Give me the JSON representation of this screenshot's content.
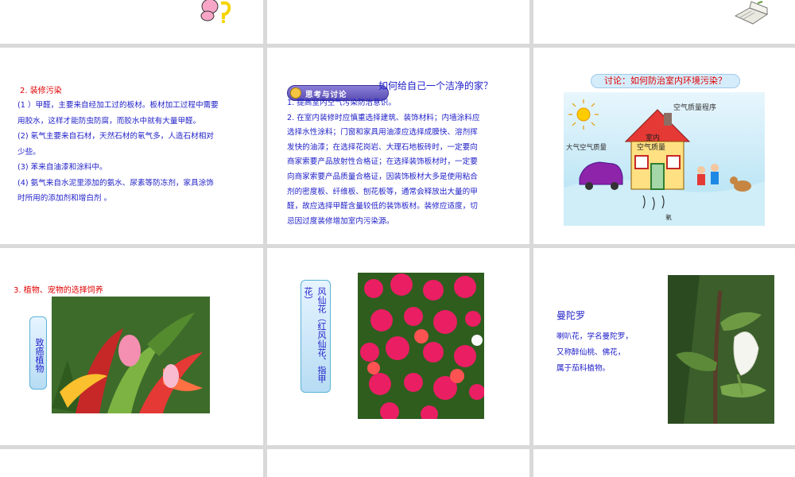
{
  "slide_row1_middle": {
    "title": "2. 装修污染",
    "lines": [
      "(1 ）甲醛，主要来自经加工过的板材。板材加工过程中需要",
      "用胶水，这样才能防虫防腐，而胶水中就有大量甲醛。",
      "(2) 氡气主要来自石材，天然石材的氡气多，人造石材相对",
      "少些。",
      "(3) 苯来自油漆和涂料中。",
      "(4) 氨气来自水泥里添加的氨水、尿素等防冻剂，家具涂饰",
      "时所用的添加剂和增白剂 。"
    ]
  },
  "slide_think": {
    "badge": "思考与讨论",
    "question": "如何给自己一个洁净的家？",
    "lines": [
      "1. 提高室内空气污染防治意识。",
      "2. 在室内装修时应慎重选择建筑、装饰材料；内墙涂料应",
      "选择水性涂料；门窗和家具用油漆应选择成膜快、溶剂挥",
      "发快的油漆；在选择花岗岩、大理石地板砖时，一定要向",
      "商家索要产品放射性合格证；在选择装饰板材时，一定要",
      "向商家索要产品质量合格证，因装饰板材大多是使用粘合",
      "剂的密度板、纤维板、刨花板等，通常会释放出大量的甲",
      "醛，故应选择甲醛含量较低的装饰板材。装修应适度，切",
      "忌因过度装修增加室内污染源。"
    ]
  },
  "slide_discuss": {
    "title": "讨论：如何防治室内环境污染？",
    "labels": {
      "program": "空气质量程序",
      "outdoor": "大气空气质量",
      "indoor_1": "室内",
      "indoor_2": "空气质量",
      "radon": "氡"
    }
  },
  "slide_plants": {
    "title": "3. 植物、宠物的选择饲养",
    "vertical_label": "致癌植物"
  },
  "slide_impatiens": {
    "vertical_label": "风仙花（红风仙花、指甲花）"
  },
  "slide_datura": {
    "title": "曼陀罗",
    "lines": [
      "喇叭花，学名曼陀罗，",
      "又称醉仙桃、佛花，",
      "属于茄科植物。"
    ]
  }
}
